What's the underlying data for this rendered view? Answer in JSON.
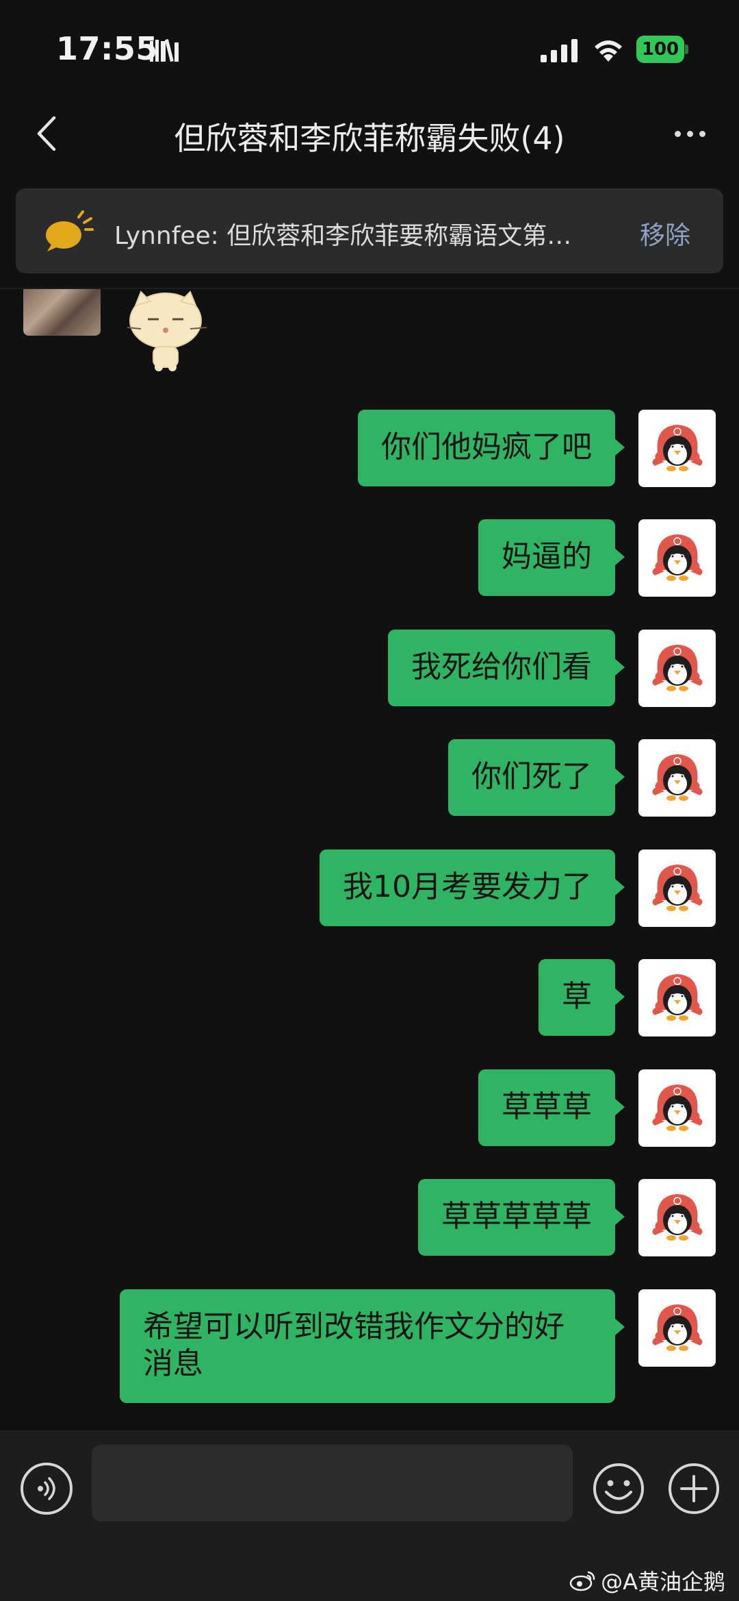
{
  "status_bar": {
    "time": "17:55",
    "battery": "100",
    "icons": [
      "books-icon",
      "signal-icon",
      "wifi-icon",
      "battery-icon"
    ]
  },
  "header": {
    "title": "但欣蓉和李欣菲称霸失败(4)",
    "back_icon": "chevron-left-icon",
    "more_icon": "more-dots-icon"
  },
  "pinned": {
    "text": "Lynnfee: 但欣蓉和李欣菲要称霸语文第…",
    "remove_label": "移除",
    "icon": "speech-bubble-icon",
    "icon_color": "#e0a81a"
  },
  "messages": [
    {
      "text": "你们他妈疯了吧"
    },
    {
      "text": "妈逼的"
    },
    {
      "text": "我死给你们看"
    },
    {
      "text": "你们死了"
    },
    {
      "text": "我10月考要发力了"
    },
    {
      "text": "草"
    },
    {
      "text": "草草草"
    },
    {
      "text": "草草草草草"
    },
    {
      "text": "希望可以听到改错我作文分的好消息"
    }
  ],
  "input_bar": {
    "placeholder": "",
    "icons": [
      "voice-icon",
      "emoji-icon",
      "plus-icon"
    ]
  },
  "watermark": {
    "text": "@A黄油企鹅",
    "icon": "weibo-icon"
  },
  "colors": {
    "background": "#111111",
    "bubble": "#2fb463",
    "pinned_bg": "#2b2b2b",
    "remove_link": "#8ea3c4",
    "battery": "#33c75a"
  }
}
